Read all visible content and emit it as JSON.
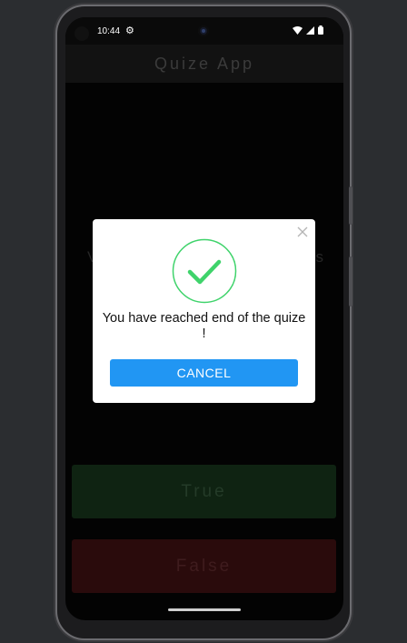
{
  "status_bar": {
    "time": "10:44"
  },
  "app_bar": {
    "title": "Quize App"
  },
  "question": {
    "partial_left": "V",
    "partial_right": "s"
  },
  "answers": {
    "true_label": "True",
    "false_label": "False"
  },
  "dialog": {
    "message": "You have reached end of the quize !",
    "cancel_label": "CANCEL"
  },
  "colors": {
    "accent": "#2196f3",
    "success": "#3fd36b",
    "true_button": "#0f2312",
    "false_button": "#2a0b0c"
  },
  "icons": [
    "gear-icon",
    "wifi-icon",
    "signal-icon",
    "battery-icon",
    "close-icon",
    "check-circle-icon"
  ]
}
